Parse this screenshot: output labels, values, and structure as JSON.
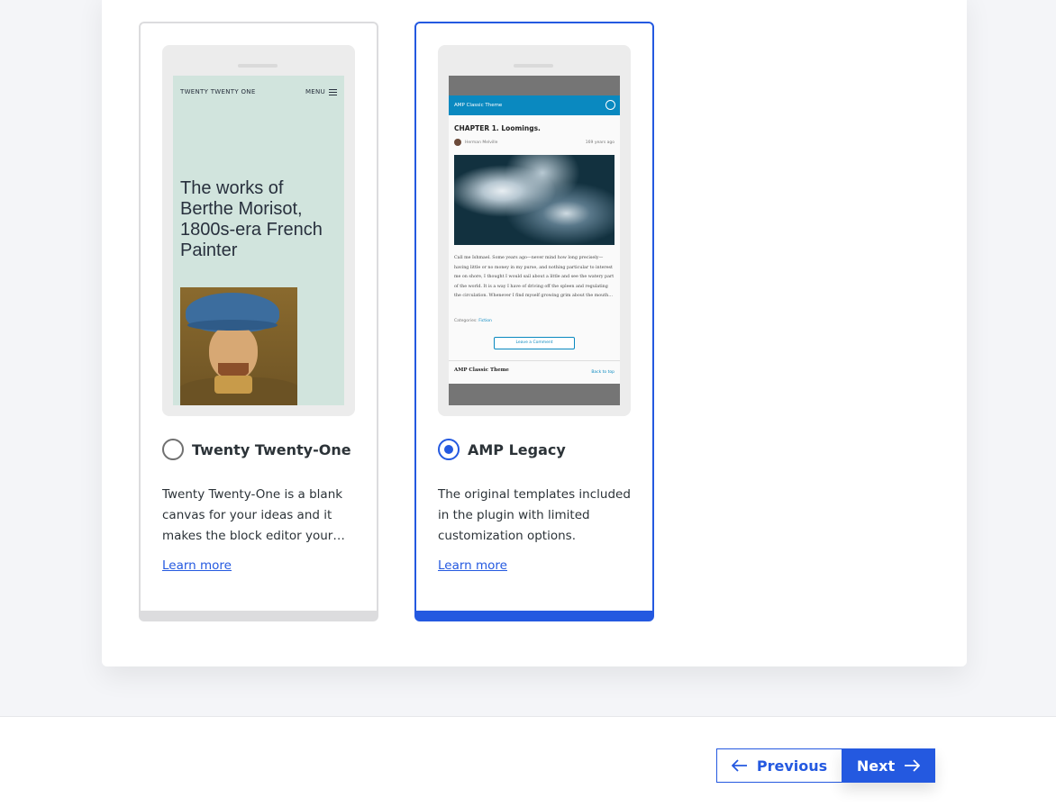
{
  "themes": [
    {
      "name": "Twenty Twenty-One",
      "description": "Twenty Twenty-One is a blank canvas for your ideas and it makes the block editor your…",
      "learn_more": "Learn more",
      "selected": false,
      "preview": {
        "site_title": "TWENTY TWENTY ONE",
        "menu_label": "MENU",
        "headline": "The works of Berthe Morisot, 1800s-era French Painter"
      }
    },
    {
      "name": "AMP Legacy",
      "description": "The original templates included in the plugin with limited customization options.",
      "learn_more": "Learn more",
      "selected": true,
      "preview": {
        "header_title": "AMP Classic Theme",
        "post_title": "CHAPTER 1. Loomings.",
        "author": "Herman Melville",
        "age": "169 years ago",
        "body": "Call me Ishmael. Some years ago—never mind how long precisely—having little or no money in my purse, and nothing particular to interest me on shore, I thought I would sail about a little and see the watery part of the world. It is a way I have of driving off the spleen and regulating the circulation. Whenever I find myself growing grim about the mouth…",
        "categories_label": "Categories:",
        "category": "Fiction",
        "comment_button": "Leave a Comment",
        "footer_title": "AMP Classic Theme",
        "back_to_top": "Back to top"
      }
    }
  ],
  "nav": {
    "previous_label": "Previous",
    "next_label": "Next"
  },
  "colors": {
    "accent": "#2459e0",
    "amp_header": "#0a89c0",
    "tt1_background": "#d1e4dd"
  }
}
